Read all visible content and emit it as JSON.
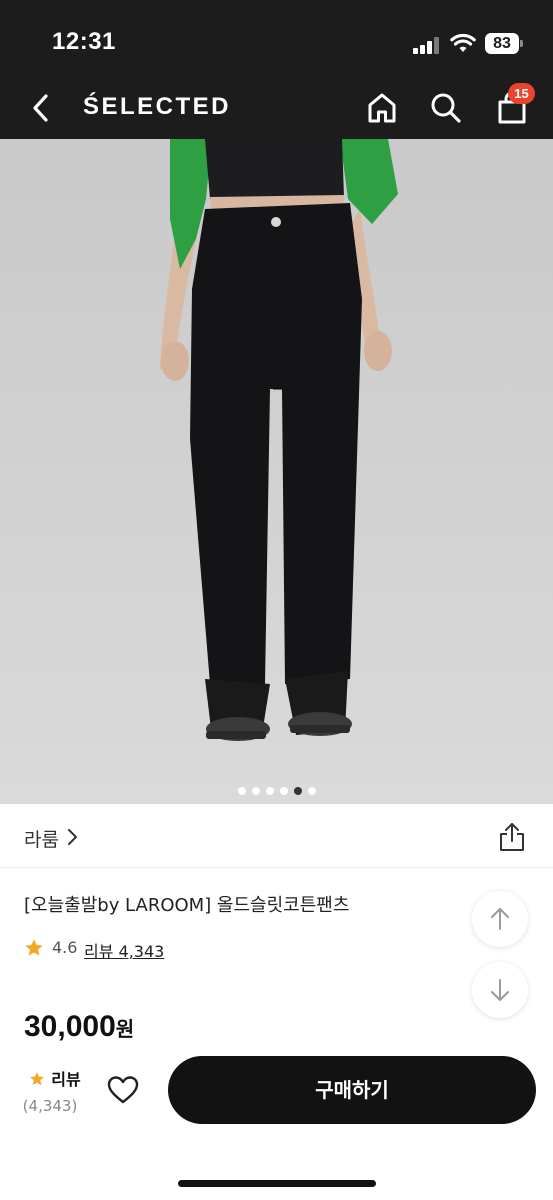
{
  "status_bar": {
    "time": "12:31",
    "battery": "83",
    "icons": [
      "signal-icon",
      "wifi-icon",
      "battery-icon"
    ]
  },
  "nav": {
    "brand": "ŚELECTED",
    "cart_count": "15",
    "icons": [
      "back-arrow-icon",
      "home-icon",
      "search-icon",
      "shopping-bag-icon"
    ]
  },
  "gallery": {
    "image_count": 6,
    "active_index": 4
  },
  "product": {
    "brand_name": "라룸",
    "title": "[오늘출발by LAROOM] 올드슬릿코튼팬츠",
    "rating": "4.6",
    "review_label": "리뷰 4,343",
    "price": "30,000",
    "currency": "원"
  },
  "bottom_bar": {
    "review_label": "리뷰",
    "review_count": "(4,343)",
    "buy_label": "구매하기"
  },
  "colors": {
    "header_bg": "#1c1c1c",
    "badge": "#e8452e",
    "star": "#f5a623",
    "buy_button": "#121212",
    "garment_top": "#2ea043"
  }
}
